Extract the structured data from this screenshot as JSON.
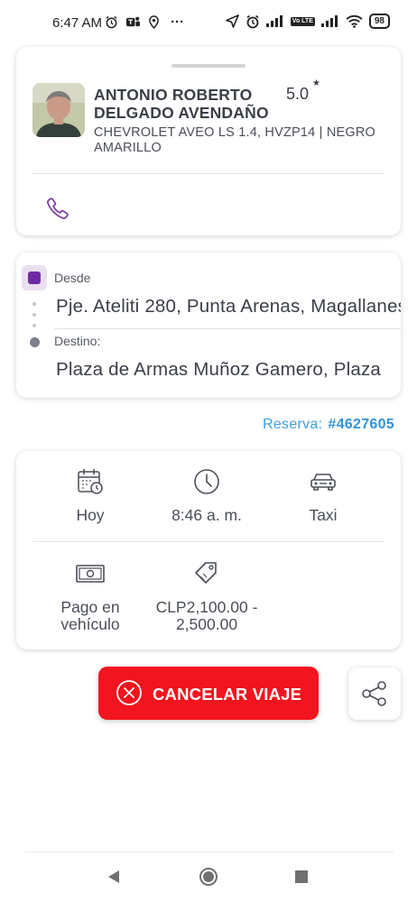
{
  "status_bar": {
    "time": "6:47 AM",
    "more": "···",
    "lte_label": "Vo LTE",
    "battery": "98"
  },
  "driver": {
    "name": "ANTONIO ROBERTO DELGADO AVENDAÑO",
    "rating": "5.0",
    "rating_star": "★",
    "vehicle": "CHEVROLET AVEO LS 1.4, HVZP14 | NEGRO\nAMARILLO",
    "call_icon": "phone-icon"
  },
  "route": {
    "origin_label": "Desde",
    "origin_value": "Pje. Ateliti 280, Punta Arenas, Magallanes",
    "destination_label": "Destino:",
    "destination_value": "Plaza de Armas Muñoz Gamero, Plaza"
  },
  "reservation": {
    "label": "Reserva:",
    "number": "#4627605"
  },
  "details": {
    "date": "Hoy",
    "time": "8:46 a. m.",
    "service": "Taxi",
    "payment": "Pago en vehículo",
    "fare": "CLP2,100.00 - 2,500.00"
  },
  "actions": {
    "cancel_label": "CANCELAR VIAJE",
    "share_icon": "share-icon"
  },
  "colors": {
    "accent_purple": "#6f2aa3",
    "cancel_red": "#f2141e",
    "link_blue": "#2e94da"
  }
}
